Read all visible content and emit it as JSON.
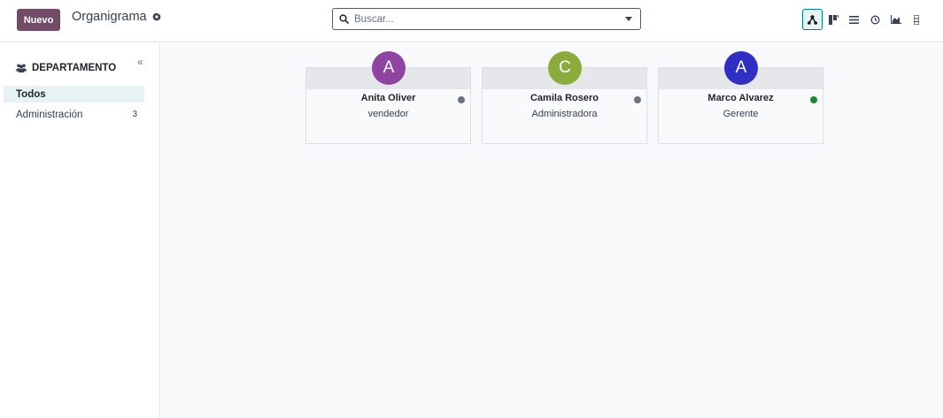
{
  "toolbar": {
    "new_label": "Nuevo",
    "title": "Organigrama"
  },
  "search": {
    "placeholder": "Buscar..."
  },
  "views": [
    "hierarchy-icon",
    "kanban-icon",
    "list-icon",
    "activity-icon",
    "graph-icon",
    "pivot-icon"
  ],
  "sidebar": {
    "heading": "DEPARTAMENTO",
    "items": [
      {
        "label": "Todos",
        "count": ""
      },
      {
        "label": "Administración",
        "count": "3"
      }
    ]
  },
  "employees": [
    {
      "initial": "A",
      "name": "Anita Oliver",
      "job": "vendedor",
      "avatar_color": "#8e44a0",
      "status": "gray"
    },
    {
      "initial": "C",
      "name": "Camila Rosero",
      "job": "Administradora",
      "avatar_color": "#8cab3d",
      "status": "gray"
    },
    {
      "initial": "A",
      "name": "Marco Alvarez",
      "job": "Gerente",
      "avatar_color": "#2f2fc4",
      "status": "green"
    }
  ],
  "colors": {
    "brand": "#714b67",
    "accent": "#017e84",
    "status_gray": "#6b7280",
    "status_green": "#1e8a2e"
  }
}
